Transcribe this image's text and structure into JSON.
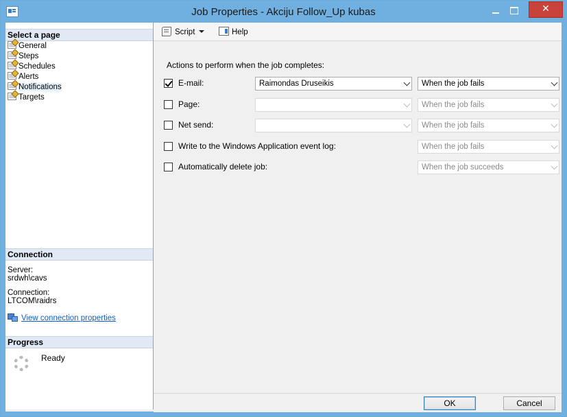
{
  "window": {
    "title": "Job Properties - Akciju Follow_Up kubas",
    "close_glyph": "✕"
  },
  "left_panel": {
    "select_page_heading": "Select a page",
    "pages": [
      {
        "label": "General",
        "icon": "page-icon"
      },
      {
        "label": "Steps",
        "icon": "page-icon"
      },
      {
        "label": "Schedules",
        "icon": "page-icon"
      },
      {
        "label": "Alerts",
        "icon": "page-icon"
      },
      {
        "label": "Notifications",
        "icon": "page-icon",
        "selected": true
      },
      {
        "label": "Targets",
        "icon": "page-icon"
      }
    ],
    "connection_heading": "Connection",
    "server_label": "Server:",
    "server_value": "srdwh\\cavs",
    "connection_label": "Connection:",
    "connection_value": "LTCOM\\raidrs",
    "view_connection_link": "View connection properties",
    "progress_heading": "Progress",
    "progress_status": "Ready"
  },
  "toolbar": {
    "script_label": "Script",
    "help_label": "Help"
  },
  "notifications": {
    "heading": "Actions to perform when the job completes:",
    "rows": [
      {
        "label": "E-mail:",
        "checked": true,
        "target": "Raimondas Druseikis",
        "condition": "When the job fails",
        "enabled": true
      },
      {
        "label": "Page:",
        "checked": false,
        "target": "",
        "condition": "When the job fails",
        "enabled": false
      },
      {
        "label": "Net send:",
        "checked": false,
        "target": "",
        "condition": "When the job fails",
        "enabled": false
      },
      {
        "label": "Write to the Windows Application event log:",
        "checked": false,
        "condition": "When the job fails",
        "enabled": false
      },
      {
        "label": "Automatically delete job:",
        "checked": false,
        "condition": "When the job succeeds",
        "enabled": false
      }
    ]
  },
  "footer": {
    "ok_label": "OK",
    "cancel_label": "Cancel"
  }
}
